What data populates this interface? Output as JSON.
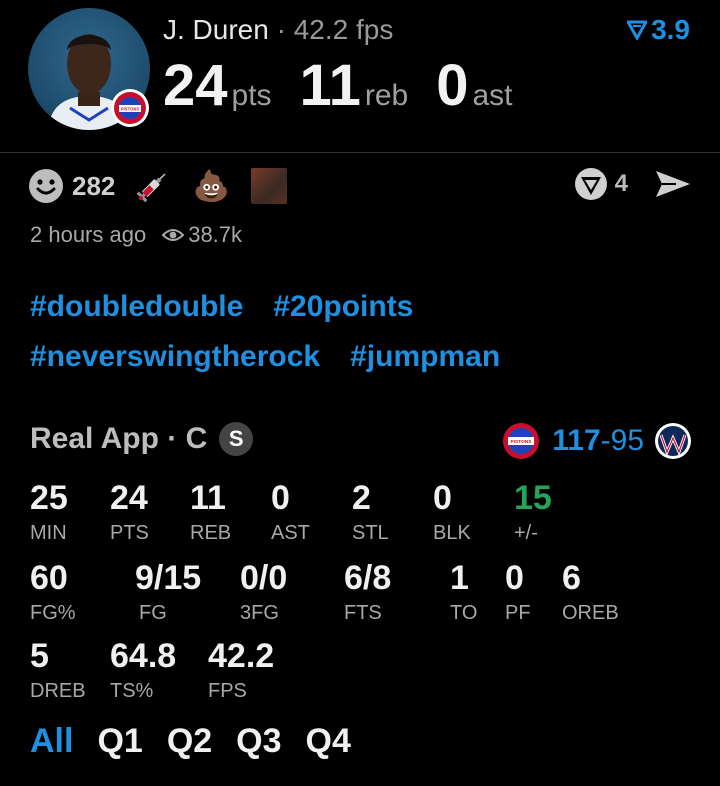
{
  "player": {
    "name": "J. Duren",
    "separator": " · ",
    "fps_text": "42.2 fps",
    "team_badge_text": "DETROIT PISTONS"
  },
  "ratio": {
    "value": "3.9"
  },
  "headline_stats": [
    {
      "value": "24",
      "unit": "pts"
    },
    {
      "value": "11",
      "unit": "reb"
    },
    {
      "value": "0",
      "unit": "ast"
    }
  ],
  "reactions": {
    "smile_count": "282",
    "poop_emoji": "💩",
    "triangle_count": "4"
  },
  "meta": {
    "time": "2 hours ago",
    "views": "38.7k"
  },
  "tags": [
    "#doubledouble",
    "#20points",
    "#neverswingtherock",
    "#jumpman"
  ],
  "game": {
    "app_label": "Real App · C",
    "badge": "S",
    "home_score": "117",
    "away_score": "-95"
  },
  "stats_row1": [
    {
      "value": "25",
      "label": "MIN"
    },
    {
      "value": "24",
      "label": "PTS"
    },
    {
      "value": "11",
      "label": "REB"
    },
    {
      "value": "0",
      "label": "AST"
    },
    {
      "value": "2",
      "label": "STL"
    },
    {
      "value": "0",
      "label": "BLK"
    },
    {
      "value": "15",
      "label": "+/-"
    }
  ],
  "stats_row2": [
    {
      "value": "60",
      "label": "FG%"
    },
    {
      "value": "9/15",
      "label": "FG"
    },
    {
      "value": "0/0",
      "label": "3FG"
    },
    {
      "value": "6/8",
      "label": "FTS"
    },
    {
      "value": "1",
      "label": "TO"
    },
    {
      "value": "0",
      "label": "PF"
    },
    {
      "value": "6",
      "label": "OREB"
    }
  ],
  "stats_row3": [
    {
      "value": "5",
      "label": "DREB"
    },
    {
      "value": "64.8",
      "label": "TS%"
    },
    {
      "value": "42.2",
      "label": "FPS"
    }
  ],
  "quarters": [
    "All",
    "Q1",
    "Q2",
    "Q3",
    "Q4"
  ],
  "colors": {
    "accent": "#1f8fe0",
    "positive": "#25a35a",
    "pistons_red": "#c8102e",
    "pistons_blue": "#1d42ba"
  }
}
